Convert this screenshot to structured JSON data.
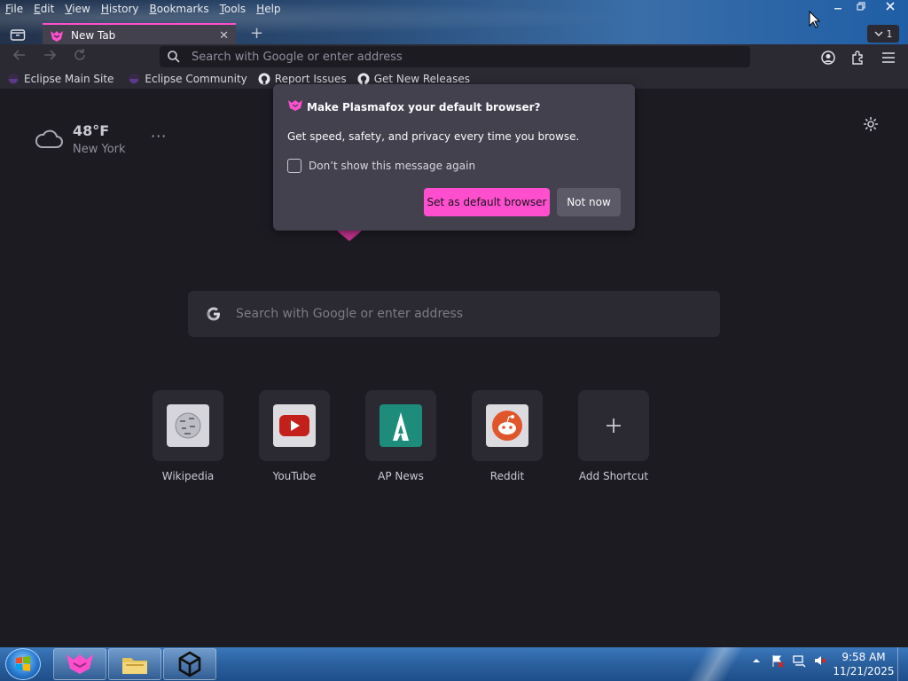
{
  "menu": [
    {
      "key": "F",
      "rest": "ile"
    },
    {
      "key": "E",
      "rest": "dit"
    },
    {
      "key": "V",
      "rest": "iew"
    },
    {
      "key": "H",
      "rest": "istory"
    },
    {
      "key": "B",
      "rest": "ookmarks"
    },
    {
      "key": "T",
      "rest": "ools"
    },
    {
      "key": "H",
      "rest": "elp"
    }
  ],
  "tab": {
    "title": "New Tab",
    "close": "✕",
    "new": "+",
    "overflow_count": "1"
  },
  "urlbar": {
    "placeholder": "Search with Google or enter address"
  },
  "bookmarks": [
    "Eclipse Main Site",
    "Eclipse Community",
    "Report Issues",
    "Get New Releases"
  ],
  "weather": {
    "temp": "48°F",
    "city": "New York",
    "more": "···"
  },
  "search": {
    "placeholder": "Search with Google or enter address"
  },
  "shortcuts": [
    {
      "label": "Wikipedia",
      "icon": "wikipedia-icon"
    },
    {
      "label": "YouTube",
      "icon": "youtube-icon"
    },
    {
      "label": "AP News",
      "icon": "apnews-icon"
    },
    {
      "label": "Reddit",
      "icon": "reddit-icon"
    },
    {
      "label": "Add Shortcut",
      "icon": "plus-icon"
    }
  ],
  "dialog": {
    "title": "Make Plasmafox your default browser?",
    "body": "Get speed, safety, and privacy every time you browse.",
    "checkbox": "Don’t show this message again",
    "primary": "Set as default browser",
    "secondary": "Not now"
  },
  "taskbar": {
    "time": "9:58 AM",
    "date": "11/21/2025"
  },
  "colors": {
    "accent": "#ff4fcf",
    "content_bg": "#1c1b22",
    "toolbar_bg": "#2b2a33",
    "dialog_bg": "#42414d"
  }
}
